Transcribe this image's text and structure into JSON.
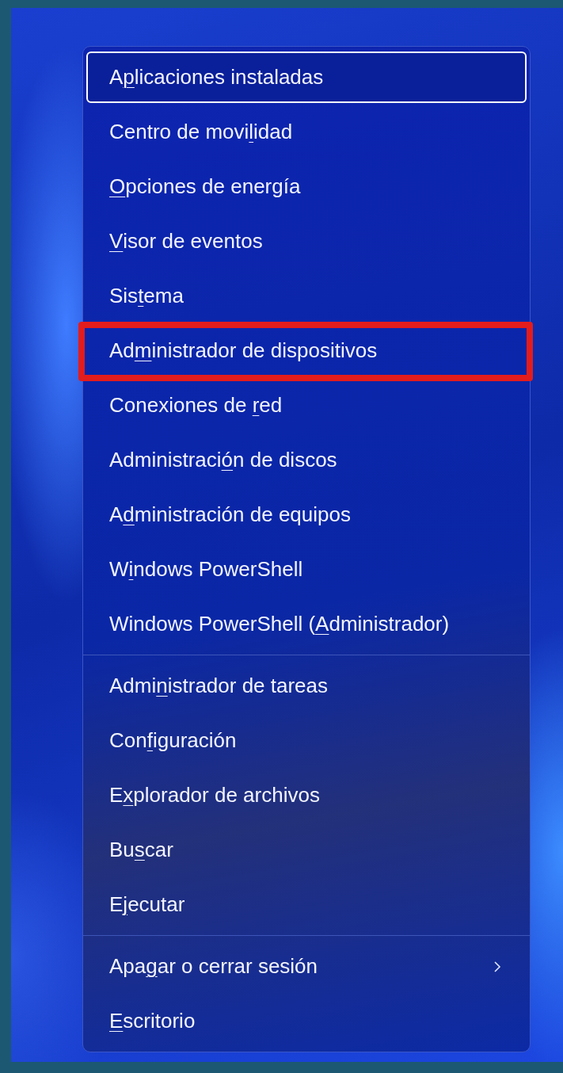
{
  "menu": {
    "groups": [
      {
        "items": [
          {
            "before": "A",
            "key": "p",
            "after": "licaciones instaladas",
            "selected": true,
            "annotated": false,
            "submenu": false
          },
          {
            "before": "Centro de movi",
            "key": "l",
            "after": "idad",
            "selected": false,
            "annotated": false,
            "submenu": false
          },
          {
            "key": "O",
            "after": "pciones de energía",
            "selected": false,
            "annotated": false,
            "submenu": false
          },
          {
            "key": "V",
            "after": "isor de eventos",
            "selected": false,
            "annotated": false,
            "submenu": false
          },
          {
            "before": "Sis",
            "key": "t",
            "after": "ema",
            "selected": false,
            "annotated": false,
            "submenu": false
          },
          {
            "before": "Ad",
            "key": "m",
            "after": "inistrador de dispositivos",
            "selected": false,
            "annotated": true,
            "submenu": false
          },
          {
            "before": "Conexiones de ",
            "key": "r",
            "after": "ed",
            "selected": false,
            "annotated": false,
            "submenu": false
          },
          {
            "before": "Administraci",
            "key": "ó",
            "after": "n de discos",
            "selected": false,
            "annotated": false,
            "submenu": false
          },
          {
            "before": "A",
            "key": "d",
            "after": "ministración de equipos",
            "selected": false,
            "annotated": false,
            "submenu": false
          },
          {
            "before": "W",
            "key": "i",
            "after": "ndows PowerShell",
            "selected": false,
            "annotated": false,
            "submenu": false
          },
          {
            "before": "Windows PowerShell (",
            "key": "A",
            "after": "dministrador)",
            "selected": false,
            "annotated": false,
            "submenu": false
          }
        ]
      },
      {
        "items": [
          {
            "before": "Admi",
            "key": "n",
            "after": "istrador de tareas",
            "selected": false,
            "annotated": false,
            "submenu": false
          },
          {
            "before": "Con",
            "key": "f",
            "after": "iguración",
            "selected": false,
            "annotated": false,
            "submenu": false
          },
          {
            "before": "E",
            "key": "x",
            "after": "plorador de archivos",
            "selected": false,
            "annotated": false,
            "submenu": false
          },
          {
            "before": "Bu",
            "key": "s",
            "after": "car",
            "selected": false,
            "annotated": false,
            "submenu": false
          },
          {
            "before": "E",
            "key": "j",
            "after": "ecutar",
            "selected": false,
            "annotated": false,
            "submenu": false
          }
        ]
      },
      {
        "items": [
          {
            "before": "Apa",
            "key": "g",
            "after": "ar o cerrar sesión",
            "selected": false,
            "annotated": false,
            "submenu": true
          },
          {
            "key": "E",
            "after": "scritorio",
            "selected": false,
            "annotated": false,
            "submenu": false
          }
        ]
      }
    ]
  }
}
